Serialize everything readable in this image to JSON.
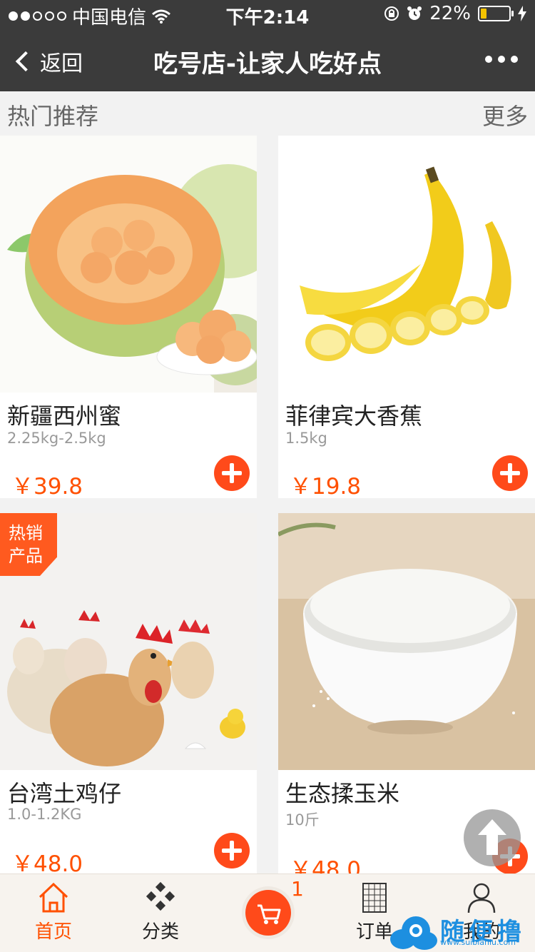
{
  "status": {
    "carrier": "中国电信",
    "time": "下午2:14",
    "battery_percent": "22%",
    "battery_level": 0.22,
    "signal_bars": 2,
    "signal_total": 5
  },
  "nav": {
    "back_label": "返回",
    "title": "吃号店-让家人吃好点"
  },
  "section": {
    "title": "热门推荐",
    "more": "更多"
  },
  "products": [
    {
      "name": "新疆西州蜜",
      "spec": "2.25kg-2.5kg",
      "price": "￥39.8"
    },
    {
      "name": "菲律宾大香蕉",
      "spec": "1.5kg",
      "price": "￥19.8"
    },
    {
      "name": "台湾土鸡仔",
      "spec": "1.0-1.2KG",
      "price": "￥48.0",
      "badge": "热销产品",
      "badge_l1": "热销",
      "badge_l2": "产品"
    },
    {
      "name": "生态揉玉米",
      "spec": "10斤",
      "price": "￥48.0"
    }
  ],
  "tabs": {
    "home": "首页",
    "category": "分类",
    "cart_count": "1",
    "orders": "订单",
    "mine": "我的"
  },
  "watermark": {
    "text": "随便撸",
    "url": "www.suibianlu.com"
  },
  "colors": {
    "accent": "#ff5000",
    "nav_bg": "#3b3b3b",
    "tab_bg": "#f7f3ee"
  }
}
